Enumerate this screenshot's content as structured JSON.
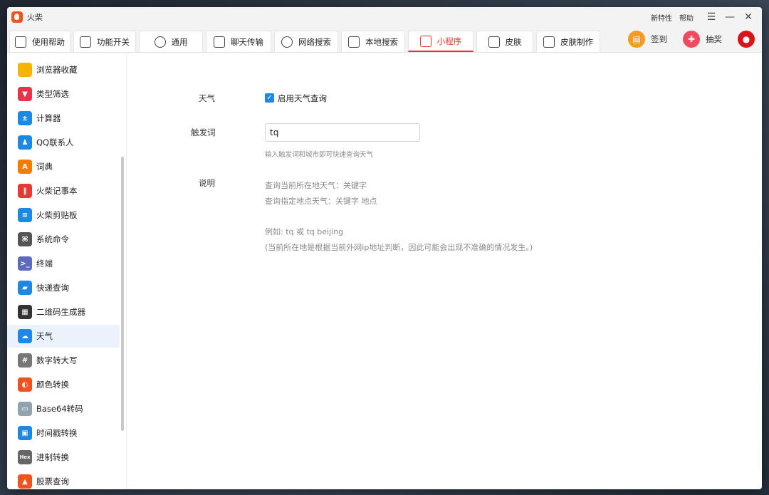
{
  "app": {
    "title": "火柴"
  },
  "titlebar": {
    "new_features": "新特性",
    "help": "帮助"
  },
  "tabs": [
    {
      "label": "使用帮助",
      "icon": "help-doc-icon"
    },
    {
      "label": "功能开关",
      "icon": "toggle-icon"
    },
    {
      "label": "通用",
      "icon": "gear-icon"
    },
    {
      "label": "聊天传输",
      "icon": "chat-icon"
    },
    {
      "label": "网络搜索",
      "icon": "globe-icon"
    },
    {
      "label": "本地搜索",
      "icon": "monitor-icon"
    },
    {
      "label": "小程序",
      "icon": "mini-program-icon",
      "active": true
    },
    {
      "label": "皮肤",
      "icon": "shirt-icon"
    },
    {
      "label": "皮肤制作",
      "icon": "tools-icon"
    }
  ],
  "tabbar_right": {
    "sign_in": "签到",
    "lottery": "抽奖"
  },
  "sidebar": {
    "items": [
      {
        "label": "浏览器收藏",
        "icon": "folder-icon",
        "color": "#f5b400"
      },
      {
        "label": "类型筛选",
        "icon": "filter-icon",
        "color": "#e8334a"
      },
      {
        "label": "计算器",
        "icon": "calculator-icon",
        "color": "#1e88e5"
      },
      {
        "label": "QQ联系人",
        "icon": "qq-icon",
        "color": "#1e88e5"
      },
      {
        "label": "词典",
        "icon": "dictionary-icon",
        "color": "#f57c00"
      },
      {
        "label": "火柴记事本",
        "icon": "notebook-icon",
        "color": "#e53935"
      },
      {
        "label": "火柴剪贴板",
        "icon": "clipboard-icon",
        "color": "#1e88e5"
      },
      {
        "label": "系统命令",
        "icon": "command-icon",
        "color": "#555555"
      },
      {
        "label": "终端",
        "icon": "terminal-icon",
        "color": "#5c6bc0"
      },
      {
        "label": "快递查询",
        "icon": "truck-icon",
        "color": "#1e88e5"
      },
      {
        "label": "二维码生成器",
        "icon": "qrcode-icon",
        "color": "#333333"
      },
      {
        "label": "天气",
        "icon": "weather-icon",
        "color": "#1e88e5",
        "active": true
      },
      {
        "label": "数字转大写",
        "icon": "number-icon",
        "color": "#777777"
      },
      {
        "label": "颜色转换",
        "icon": "palette-icon",
        "color": "#f4511e"
      },
      {
        "label": "Base64转码",
        "icon": "file-icon",
        "color": "#90a4ae"
      },
      {
        "label": "时间戳转换",
        "icon": "calendar-icon",
        "color": "#1e88e5"
      },
      {
        "label": "进制转换",
        "icon": "hex-icon",
        "color": "#666666"
      },
      {
        "label": "股票查询",
        "icon": "stock-icon",
        "color": "#f4511e"
      }
    ]
  },
  "weather": {
    "label_weather": "天气",
    "enable_label": "启用天气查询",
    "enabled": true,
    "label_trigger": "触发词",
    "trigger_value": "tq",
    "trigger_hint": "输入触发词和城市即可快速查询天气",
    "label_desc": "说明",
    "desc_line1": "查询当前所在地天气：关键字",
    "desc_line2": "查询指定地点天气：关键字 地点",
    "desc_example": "例如: tq 或 tq beijing",
    "desc_note": "(当前所在地是根据当前外网ip地址判断，因此可能会出现不准确的情况发生。)"
  },
  "hex_badge": "Hex"
}
